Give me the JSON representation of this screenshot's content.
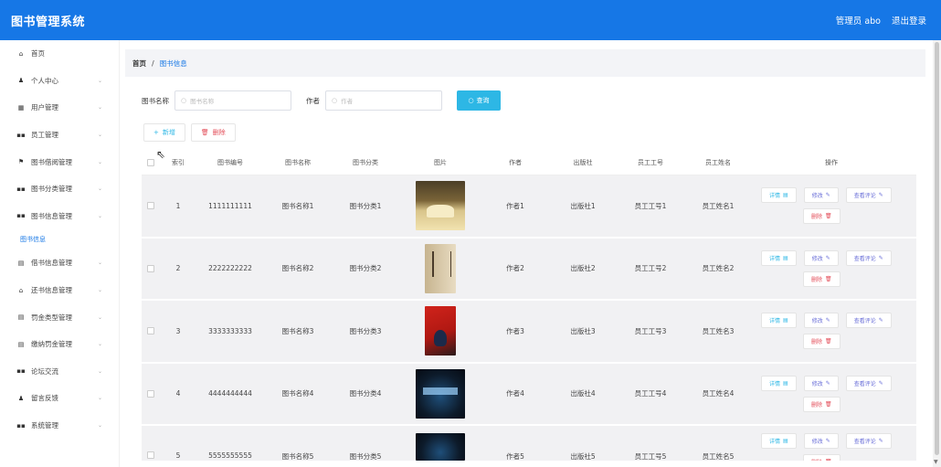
{
  "header": {
    "title": "图书管理系统",
    "user_label": "管理员 abo",
    "logout_label": "退出登录"
  },
  "sidebar": {
    "items": [
      {
        "label": "首页",
        "icon": "home-icon",
        "glyph": "⌂",
        "chevron": false
      },
      {
        "label": "个人中心",
        "icon": "user-icon",
        "glyph": "♟",
        "chevron": true
      },
      {
        "label": "用户管理",
        "icon": "users-icon",
        "glyph": "▦",
        "chevron": true
      },
      {
        "label": "员工管理",
        "icon": "grid-icon",
        "glyph": "▪▪",
        "chevron": true
      },
      {
        "label": "图书借阅管理",
        "icon": "flag-icon",
        "glyph": "⚑",
        "chevron": true
      },
      {
        "label": "图书分类管理",
        "icon": "grid-icon",
        "glyph": "▪▪",
        "chevron": true
      },
      {
        "label": "图书信息管理",
        "icon": "grid-icon",
        "glyph": "▪▪",
        "chevron": true
      }
    ],
    "active_sub": "图书信息",
    "items_after": [
      {
        "label": "借书信息管理",
        "icon": "book-icon",
        "glyph": "▤",
        "chevron": true
      },
      {
        "label": "还书信息管理",
        "icon": "bank-icon",
        "glyph": "⌂",
        "chevron": true
      },
      {
        "label": "罚金类型管理",
        "icon": "doc-icon",
        "glyph": "▤",
        "chevron": true
      },
      {
        "label": "缴纳罚金管理",
        "icon": "doc-icon",
        "glyph": "▤",
        "chevron": true
      },
      {
        "label": "论坛交流",
        "icon": "grid-icon",
        "glyph": "▪▪",
        "chevron": true
      },
      {
        "label": "留言反馈",
        "icon": "user-icon",
        "glyph": "♟",
        "chevron": true
      },
      {
        "label": "系统管理",
        "icon": "grid-icon",
        "glyph": "▪▪",
        "chevron": true
      }
    ]
  },
  "breadcrumb": {
    "home": "首页",
    "separator": "/",
    "current": "图书信息"
  },
  "search": {
    "name_label": "图书名称",
    "name_placeholder": "图书名称",
    "author_label": "作者",
    "author_placeholder": "作者",
    "query_label": "查询"
  },
  "actions": {
    "add_label": "新增",
    "delete_label": "删除"
  },
  "table": {
    "columns": [
      "索引",
      "图书编号",
      "图书名称",
      "图书分类",
      "图片",
      "作者",
      "出版社",
      "员工工号",
      "员工姓名",
      "操作"
    ],
    "op_labels": {
      "detail": "详情",
      "edit": "修改",
      "review": "查看评论",
      "delete": "删除"
    },
    "rows": [
      {
        "index": "1",
        "code": "1111111111",
        "name": "图书名称1",
        "category": "图书分类1",
        "author": "作者1",
        "publisher": "出版社1",
        "emp_no": "员工工号1",
        "emp_name": "员工姓名1"
      },
      {
        "index": "2",
        "code": "2222222222",
        "name": "图书名称2",
        "category": "图书分类2",
        "author": "作者2",
        "publisher": "出版社2",
        "emp_no": "员工工号2",
        "emp_name": "员工姓名2"
      },
      {
        "index": "3",
        "code": "3333333333",
        "name": "图书名称3",
        "category": "图书分类3",
        "author": "作者3",
        "publisher": "出版社3",
        "emp_no": "员工工号3",
        "emp_name": "员工姓名3"
      },
      {
        "index": "4",
        "code": "4444444444",
        "name": "图书名称4",
        "category": "图书分类4",
        "author": "作者4",
        "publisher": "出版社4",
        "emp_no": "员工工号4",
        "emp_name": "员工姓名4"
      },
      {
        "index": "5",
        "code": "5555555555",
        "name": "图书名称5",
        "category": "图书分类5",
        "author": "作者5",
        "publisher": "出版社5",
        "emp_no": "员工工号5",
        "emp_name": "员工姓名5"
      }
    ]
  },
  "colors": {
    "topbar": "#1677e6",
    "accent": "#2db7e5",
    "danger": "#e34d59",
    "edit": "#6a6fd8"
  }
}
